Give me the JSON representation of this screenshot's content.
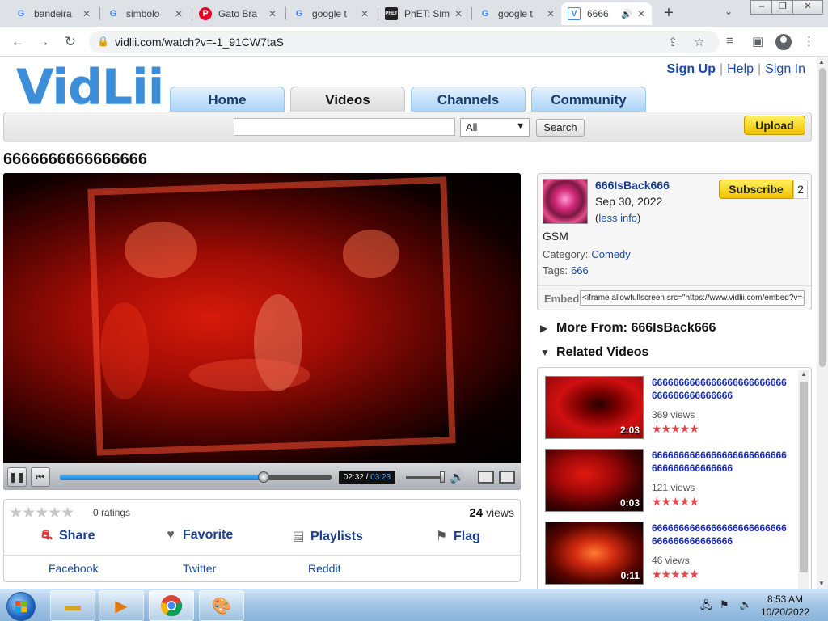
{
  "browser": {
    "tabs": [
      {
        "title": "bandeira",
        "favicon": "G"
      },
      {
        "title": "simbolo",
        "favicon": "G"
      },
      {
        "title": "Gato Bra",
        "favicon": "P"
      },
      {
        "title": "google t",
        "favicon": "G"
      },
      {
        "title": "PhET: Sim",
        "favicon": "PhET"
      },
      {
        "title": "google t",
        "favicon": "G"
      },
      {
        "title": "6666",
        "favicon": "V"
      }
    ],
    "url": "vidlii.com/watch?v=-1_91CW7taS"
  },
  "site": {
    "logo": "VidLii",
    "top_links": {
      "sign_up": "Sign Up",
      "help": "Help",
      "sign_in": "Sign In",
      "sep": "|"
    },
    "nav": [
      "Home",
      "Videos",
      "Channels",
      "Community"
    ],
    "search": {
      "filter": "All",
      "button": "Search"
    },
    "upload": "Upload"
  },
  "video": {
    "title": "6666666666666666",
    "time_current": "02:32",
    "time_sep": "/",
    "time_total": "03:23",
    "progress_fraction": 0.75,
    "ratings": "0 ratings",
    "views_count": "24",
    "views_label": "views",
    "actions": {
      "share": "Share",
      "favorite": "Favorite",
      "playlists": "Playlists",
      "flag": "Flag"
    },
    "share_links": {
      "facebook": "Facebook",
      "twitter": "Twitter",
      "reddit": "Reddit"
    }
  },
  "uploader": {
    "name": "666IsBack666",
    "date": "Sep 30, 2022",
    "less_info_open": "(",
    "less_info": "less info",
    "less_info_close": ")",
    "subscribe": "Subscribe",
    "subscribers": "2",
    "description": "GSM",
    "category_label": "Category:",
    "category": "Comedy",
    "tags_label": "Tags:",
    "tags": "666",
    "embed_label": "Embed",
    "embed_code": "<iframe allowfullscreen src=\"https://www.vidlii.com/embed?v=-"
  },
  "sections": {
    "more_from": "More From: 666IsBack666",
    "related": "Related Videos"
  },
  "related_videos": [
    {
      "title": "6666666666666666666666666666666666666666",
      "views": "369 views",
      "duration": "2:03",
      "rating_stars": 5
    },
    {
      "title": "6666666666666666666666666666666666666666",
      "views": "121 views",
      "duration": "0:03",
      "rating_stars": 5
    },
    {
      "title": "6666666666666666666666666666666666666666",
      "views": "46 views",
      "duration": "0:11",
      "rating_stars": 5
    }
  ],
  "taskbar": {
    "time": "8:53 AM",
    "date": "10/20/2022"
  },
  "colors": {
    "link": "#1a4aa5",
    "logo": "#3d8ed8",
    "button_yellow": "#f0c200",
    "star_red": "#e8474c"
  }
}
